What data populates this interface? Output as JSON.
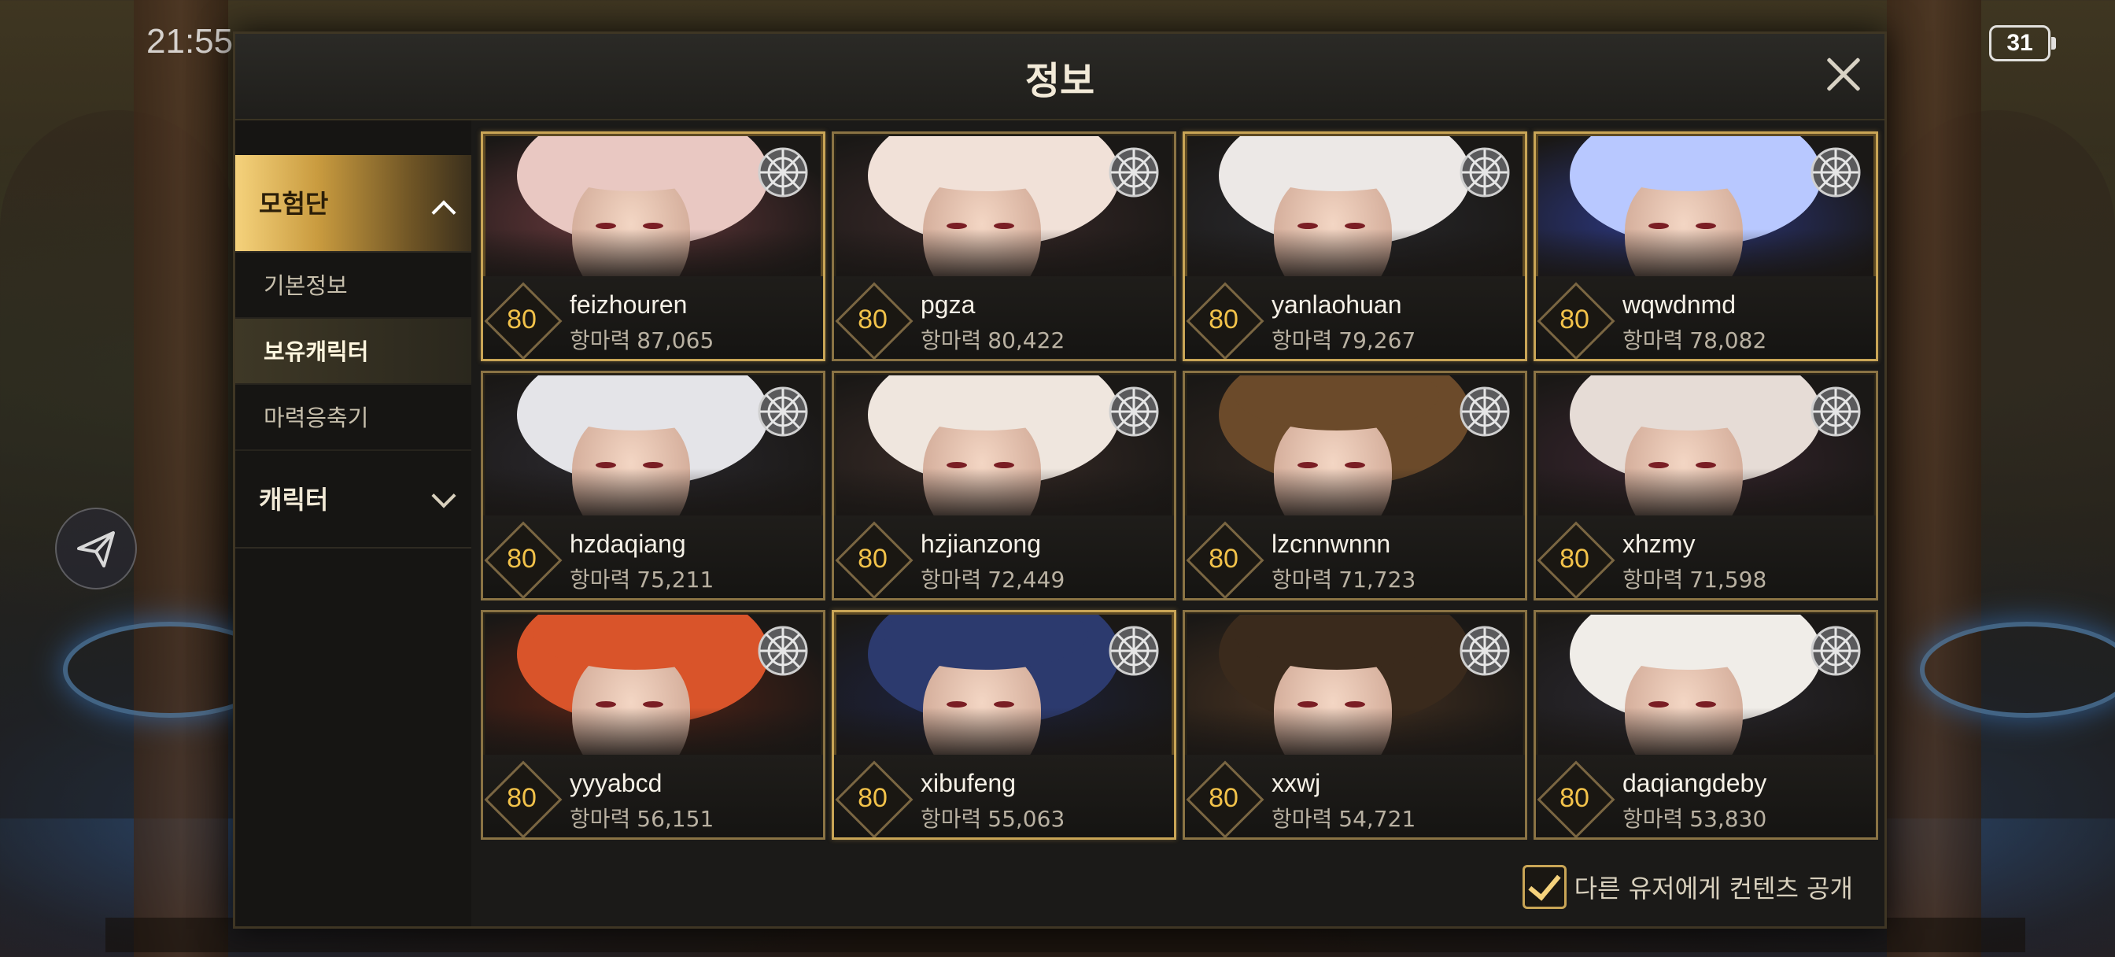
{
  "status": {
    "time": "21:55",
    "battery": "31"
  },
  "modal": {
    "title": "정보",
    "sidebar": {
      "groups": [
        {
          "label": "모험단",
          "expanded": true,
          "items": [
            {
              "label": "기본정보",
              "active": false
            },
            {
              "label": "보유캐릭터",
              "active": true
            },
            {
              "label": "마력응축기",
              "active": false
            }
          ]
        },
        {
          "label": "캐릭터",
          "expanded": false
        }
      ]
    },
    "power_label": "항마력",
    "characters": [
      {
        "level": "80",
        "name": "feizhouren",
        "power": "87,065",
        "hair": "#e9c8c2",
        "bg": "#6b3a3e",
        "frame": "gold"
      },
      {
        "level": "80",
        "name": "pgza",
        "power": "80,422",
        "hair": "#f1e1d8",
        "bg": "#3b2a2a",
        "frame": "normal"
      },
      {
        "level": "80",
        "name": "yanlaohuan",
        "power": "79,267",
        "hair": "#ece8e6",
        "bg": "#2a2a2e",
        "frame": "gold"
      },
      {
        "level": "80",
        "name": "wqwdnmd",
        "power": "78,082",
        "hair": "#b8c8ff",
        "bg": "#2d3a8a",
        "frame": "gold"
      },
      {
        "level": "80",
        "name": "hzdaqiang",
        "power": "75,211",
        "hair": "#e4e4e8",
        "bg": "#2c2a30",
        "frame": "normal"
      },
      {
        "level": "80",
        "name": "hzjianzong",
        "power": "72,449",
        "hair": "#efe6de",
        "bg": "#3a2c28",
        "frame": "normal"
      },
      {
        "level": "80",
        "name": "lzcnnwnnn",
        "power": "71,723",
        "hair": "#6b4a2a",
        "bg": "#2f2620",
        "frame": "normal"
      },
      {
        "level": "80",
        "name": "xhzmy",
        "power": "71,598",
        "hair": "#e6dcd6",
        "bg": "#3a2630",
        "frame": "normal"
      },
      {
        "level": "80",
        "name": "yyyabcd",
        "power": "56,151",
        "hair": "#d9542a",
        "bg": "#5a2416",
        "frame": "normal"
      },
      {
        "level": "80",
        "name": "xibufeng",
        "power": "55,063",
        "hair": "#2c3a6e",
        "bg": "#1d2340",
        "frame": "gold"
      },
      {
        "level": "80",
        "name": "xxwj",
        "power": "54,721",
        "hair": "#3a2a1c",
        "bg": "#4a3422",
        "frame": "normal"
      },
      {
        "level": "80",
        "name": "daqiangdeby",
        "power": "53,830",
        "hair": "#f0ede8",
        "bg": "#2c2a32",
        "frame": "normal"
      }
    ],
    "public_toggle": {
      "label": "다른 유저에게 컨텐츠 공개",
      "checked": true
    }
  },
  "colors": {
    "accent_gold": "#c9a556",
    "level_gold": "#f2c24a"
  }
}
